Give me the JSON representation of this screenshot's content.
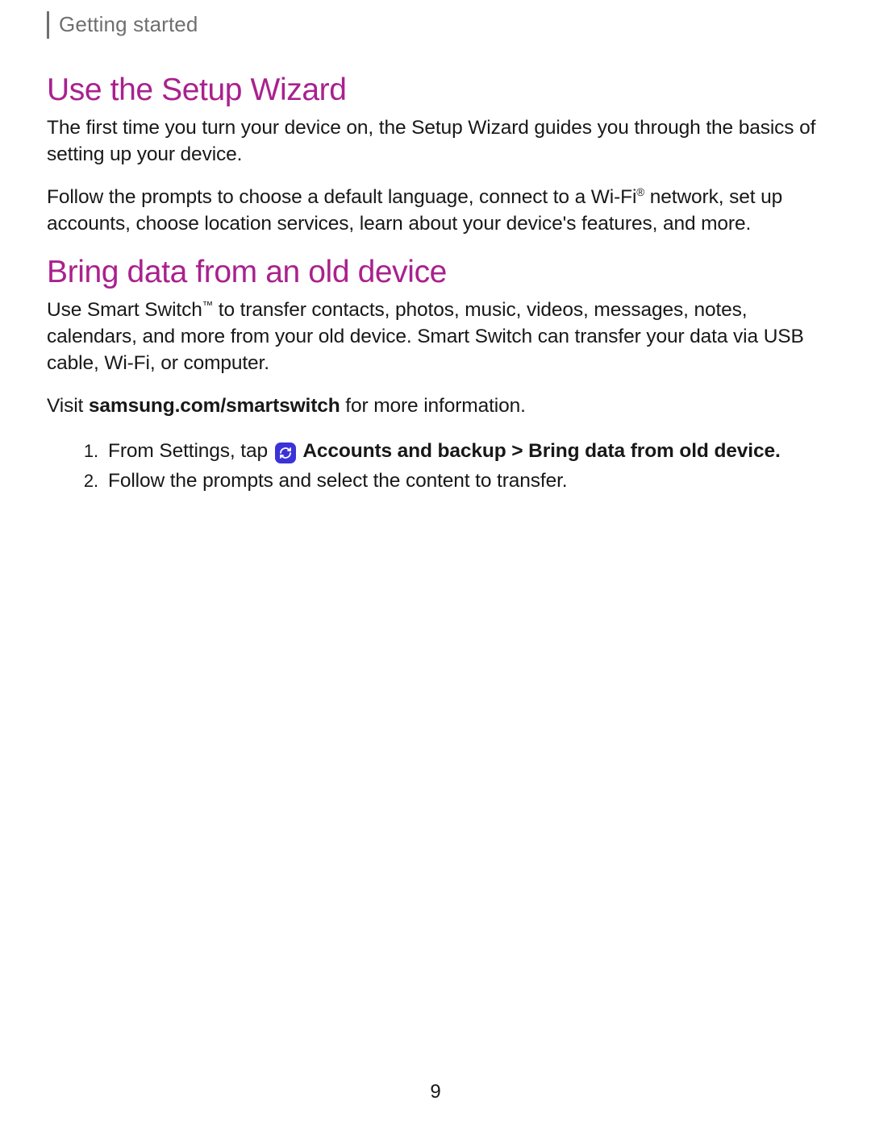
{
  "breadcrumb": "Getting started",
  "sections": [
    {
      "title": "Use the Setup Wizard",
      "paragraphs": [
        "The first time you turn your device on, the Setup Wizard guides you through the basics of setting up your device.",
        "Follow the prompts to choose a default language, connect to a Wi-Fi® network, set up accounts, choose location services, learn about your device's features, and more."
      ]
    },
    {
      "title": "Bring data from an old device",
      "intro": "Use Smart Switch™ to transfer contacts, photos, music, videos, messages, notes, calendars, and more from your old device. Smart Switch can transfer your data via USB cable, Wi-Fi, or computer.",
      "visit_prefix": "Visit ",
      "visit_bold": "samsung.com/smartswitch",
      "visit_suffix": " for more information.",
      "steps": {
        "s1_prefix": "From Settings, tap ",
        "s1_bold": " Accounts and backup > Bring data from old device.",
        "s2": "Follow the prompts and select the content to transfer."
      }
    }
  ],
  "page_number": "9",
  "colors": {
    "heading_purple": "#a9218e",
    "icon_bg": "#3b33d8"
  }
}
